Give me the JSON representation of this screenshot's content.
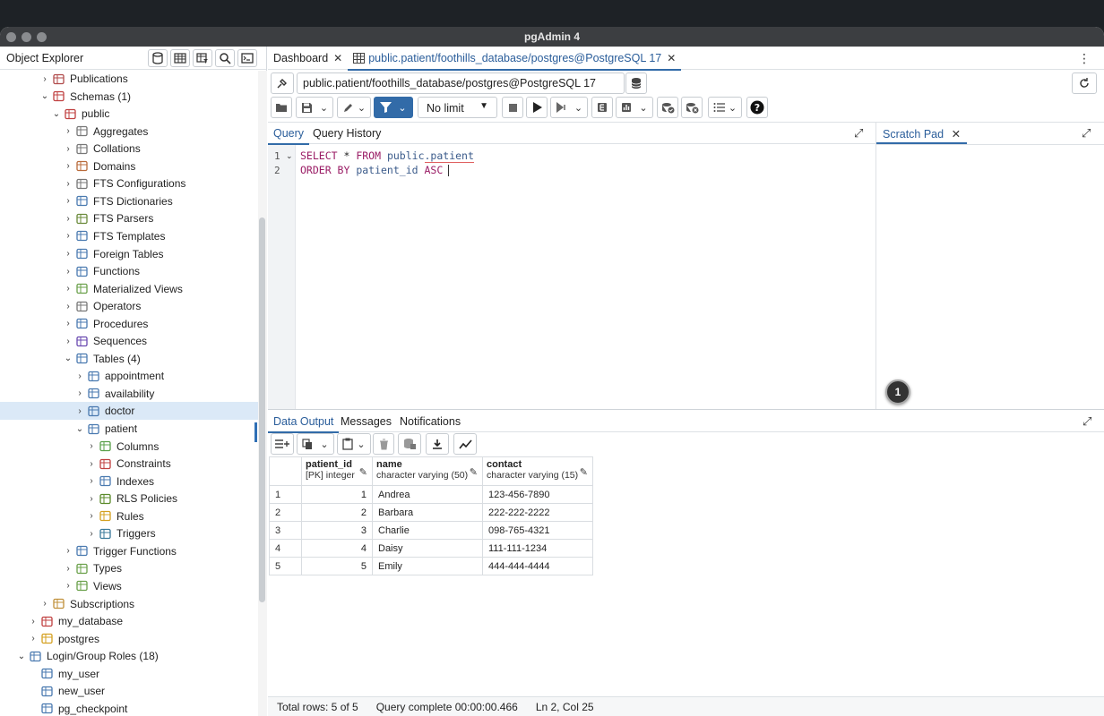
{
  "window": {
    "title": "pgAdmin 4"
  },
  "explorer": {
    "title": "Object Explorer",
    "tree": [
      {
        "label": "Publications",
        "level": 2,
        "chev": "›",
        "icon": "publications-icon",
        "color": "#b04a4a"
      },
      {
        "label": "Schemas (1)",
        "level": 2,
        "chev": "⌄",
        "icon": "schemas-icon",
        "color": "#c04040"
      },
      {
        "label": "public",
        "level": 3,
        "chev": "⌄",
        "icon": "schema-icon",
        "color": "#c04040"
      },
      {
        "label": "Aggregates",
        "level": 4,
        "chev": "›",
        "icon": "aggregates-icon",
        "color": "#777"
      },
      {
        "label": "Collations",
        "level": 4,
        "chev": "›",
        "icon": "collations-icon",
        "color": "#777"
      },
      {
        "label": "Domains",
        "level": 4,
        "chev": "›",
        "icon": "domains-icon",
        "color": "#b96b3b"
      },
      {
        "label": "FTS Configurations",
        "level": 4,
        "chev": "›",
        "icon": "fts-configurations-icon",
        "color": "#777"
      },
      {
        "label": "FTS Dictionaries",
        "level": 4,
        "chev": "›",
        "icon": "fts-dictionaries-icon",
        "color": "#4a7ab0"
      },
      {
        "label": "FTS Parsers",
        "level": 4,
        "chev": "›",
        "icon": "fts-parsers-icon",
        "color": "#6a8a3a"
      },
      {
        "label": "FTS Templates",
        "level": 4,
        "chev": "›",
        "icon": "fts-templates-icon",
        "color": "#4a7ab0"
      },
      {
        "label": "Foreign Tables",
        "level": 4,
        "chev": "›",
        "icon": "foreign-tables-icon",
        "color": "#4a7ab0"
      },
      {
        "label": "Functions",
        "level": 4,
        "chev": "›",
        "icon": "functions-icon",
        "color": "#4a7ab0"
      },
      {
        "label": "Materialized Views",
        "level": 4,
        "chev": "›",
        "icon": "materialized-views-icon",
        "color": "#6aa04a"
      },
      {
        "label": "Operators",
        "level": 4,
        "chev": "›",
        "icon": "operators-icon",
        "color": "#777"
      },
      {
        "label": "Procedures",
        "level": 4,
        "chev": "›",
        "icon": "procedures-icon",
        "color": "#4a7ab0"
      },
      {
        "label": "Sequences",
        "level": 4,
        "chev": "›",
        "icon": "sequences-icon",
        "color": "#6a4ab0"
      },
      {
        "label": "Tables (4)",
        "level": 4,
        "chev": "⌄",
        "icon": "tables-icon",
        "color": "#4a7ab0"
      },
      {
        "label": "appointment",
        "level": 5,
        "chev": "›",
        "icon": "table-icon",
        "color": "#4a7ab0"
      },
      {
        "label": "availability",
        "level": 5,
        "chev": "›",
        "icon": "table-icon",
        "color": "#4a7ab0"
      },
      {
        "label": "doctor",
        "level": 5,
        "chev": "›",
        "icon": "table-icon",
        "color": "#4a7ab0",
        "selected": true
      },
      {
        "label": "patient",
        "level": 5,
        "chev": "⌄",
        "icon": "table-icon",
        "color": "#4a7ab0"
      },
      {
        "label": "Columns",
        "level": 6,
        "chev": "›",
        "icon": "columns-icon",
        "color": "#5aa04a"
      },
      {
        "label": "Constraints",
        "level": 6,
        "chev": "›",
        "icon": "constraints-icon",
        "color": "#c04040"
      },
      {
        "label": "Indexes",
        "level": 6,
        "chev": "›",
        "icon": "indexes-icon",
        "color": "#4a7ab0"
      },
      {
        "label": "RLS Policies",
        "level": 6,
        "chev": "›",
        "icon": "rls-policies-icon",
        "color": "#5a8a2a"
      },
      {
        "label": "Rules",
        "level": 6,
        "chev": "›",
        "icon": "rules-icon",
        "color": "#d4a020"
      },
      {
        "label": "Triggers",
        "level": 6,
        "chev": "›",
        "icon": "triggers-icon",
        "color": "#3a7a9a"
      },
      {
        "label": "Trigger Functions",
        "level": 4,
        "chev": "›",
        "icon": "trigger-functions-icon",
        "color": "#4a7ab0"
      },
      {
        "label": "Types",
        "level": 4,
        "chev": "›",
        "icon": "types-icon",
        "color": "#6aa04a"
      },
      {
        "label": "Views",
        "level": 4,
        "chev": "›",
        "icon": "views-icon",
        "color": "#6aa04a"
      },
      {
        "label": "Subscriptions",
        "level": 2,
        "chev": "›",
        "icon": "subscriptions-icon",
        "color": "#c0903a"
      },
      {
        "label": "my_database",
        "level": 1,
        "chev": "›",
        "icon": "database-icon",
        "color": "#c04040"
      },
      {
        "label": "postgres",
        "level": 1,
        "chev": "›",
        "icon": "database-icon",
        "color": "#d4a020"
      },
      {
        "label": "Login/Group Roles (18)",
        "level": 0,
        "chev": "⌄",
        "icon": "roles-icon",
        "color": "#4a7ab0"
      },
      {
        "label": "my_user",
        "level": 1,
        "chev": "",
        "icon": "user-icon",
        "color": "#4a7ab0"
      },
      {
        "label": "new_user",
        "level": 1,
        "chev": "",
        "icon": "user-icon",
        "color": "#4a7ab0"
      },
      {
        "label": "pg_checkpoint",
        "level": 1,
        "chev": "",
        "icon": "group-icon",
        "color": "#4a7ab0"
      }
    ]
  },
  "tabs": {
    "dashboard": "Dashboard",
    "query_tab": "public.patient/foothills_database/postgres@PostgreSQL 17"
  },
  "connection": {
    "text": "public.patient/foothills_database/postgres@PostgreSQL 17"
  },
  "toolbar": {
    "limit": "No limit"
  },
  "query_tabs": {
    "query": "Query",
    "history": "Query History"
  },
  "scratch": {
    "label": "Scratch Pad"
  },
  "editor": {
    "line1_num": "1",
    "line2_num": "2",
    "line1": {
      "select": "SELECT",
      "star": " * ",
      "from": "FROM",
      "schema": " public",
      "table": ".patient"
    },
    "line2": {
      "order": "ORDER BY",
      "col": " patient_id ",
      "asc": "ASC"
    }
  },
  "badge": "1",
  "output_tabs": {
    "data": "Data Output",
    "messages": "Messages",
    "notifications": "Notifications"
  },
  "grid": {
    "columns": [
      {
        "name": "patient_id",
        "type": "[PK] integer"
      },
      {
        "name": "name",
        "type": "character varying (50)"
      },
      {
        "name": "contact",
        "type": "character varying (15)"
      }
    ],
    "rows": [
      {
        "rn": "1",
        "id": "1",
        "name": "Andrea",
        "contact": "123-456-7890"
      },
      {
        "rn": "2",
        "id": "2",
        "name": "Barbara",
        "contact": "222-222-2222"
      },
      {
        "rn": "3",
        "id": "3",
        "name": "Charlie",
        "contact": "098-765-4321"
      },
      {
        "rn": "4",
        "id": "4",
        "name": "Daisy",
        "contact": "111-111-1234"
      },
      {
        "rn": "5",
        "id": "5",
        "name": "Emily",
        "contact": "444-444-4444"
      }
    ]
  },
  "status": {
    "rows": "Total rows: 5 of 5",
    "query": "Query complete 00:00:00.466",
    "pos": "Ln 2, Col 25"
  }
}
